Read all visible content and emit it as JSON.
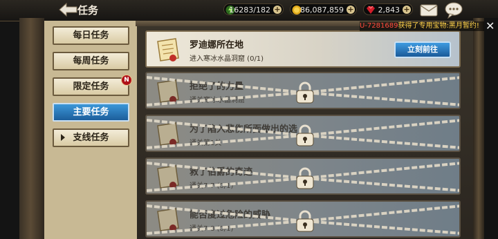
{
  "header": {
    "title": "任务",
    "stamina": "16283/182",
    "gold": "86,087,859",
    "gems": "2,843"
  },
  "notice": {
    "uid": "U-7281689",
    "message": "获得了专用宝物:黑月暂约!"
  },
  "tabs": [
    {
      "label": "每日任务",
      "active": false
    },
    {
      "label": "每周任务",
      "active": false
    },
    {
      "label": "限定任务",
      "active": false,
      "badge": "N"
    },
    {
      "label": "主要任务",
      "active": true
    },
    {
      "label": "支线任务",
      "active": false
    }
  ],
  "quests": [
    {
      "name": "罗迪娜所在地",
      "desc": "进入寒冰水晶洞窟 (0/1)",
      "button": "立刻前往",
      "locked": false
    },
    {
      "name": "拒绝了的力量",
      "desc": "通关寒冰水晶洞窟",
      "locked": true
    },
    {
      "name": "为了陷入悲伤所面做出的选",
      "desc": "通关第1关",
      "locked": true
    },
    {
      "name": "救了伯爵的奇迹",
      "desc": "通关7-7 (0/1)",
      "locked": true
    },
    {
      "name": "能否度过危险的威胁",
      "desc": "通关7-8 (0/1)",
      "locked": true
    }
  ],
  "colors": {
    "accent_blue": "#2a7cc4",
    "notice_red": "#ff4a3c",
    "notice_yellow": "#ffd24a"
  }
}
